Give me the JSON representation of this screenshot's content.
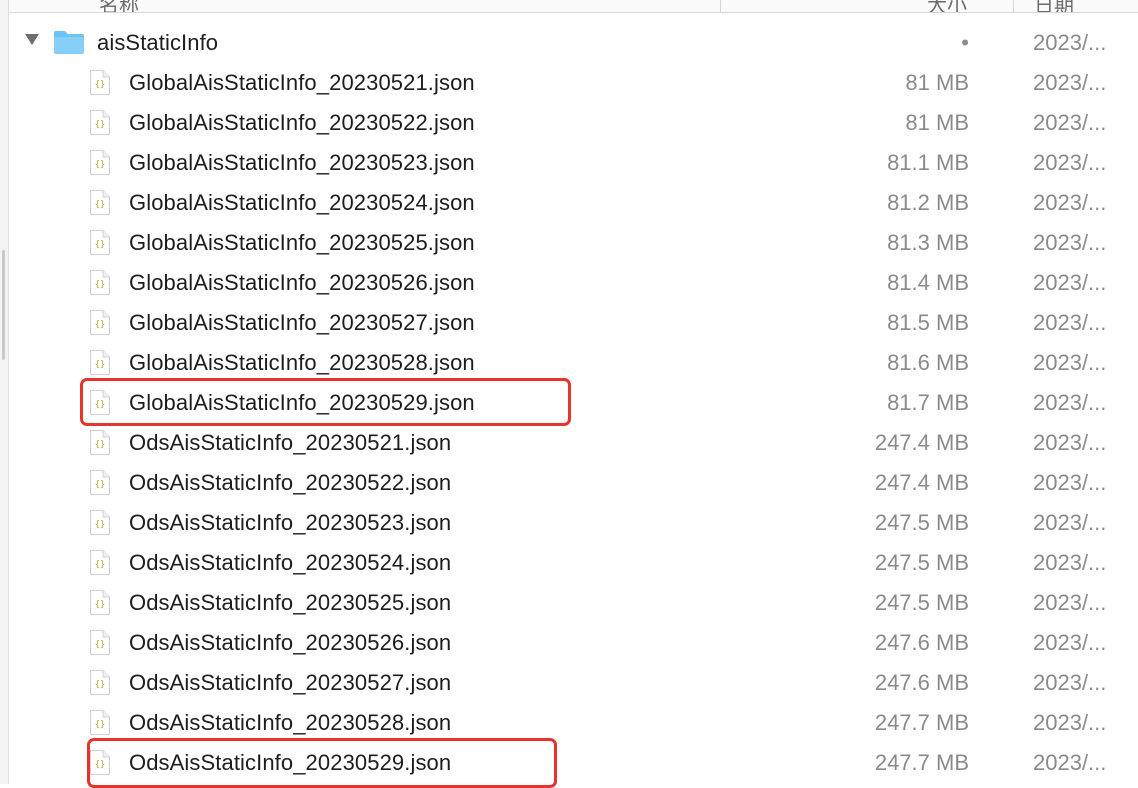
{
  "header": {
    "columns": [
      {
        "label": "名称"
      },
      {
        "label": "大小"
      },
      {
        "label": "日期"
      }
    ]
  },
  "folder": {
    "name": "aisStaticInfo",
    "size": "•",
    "date": "2023/...",
    "expanded": true,
    "icon": "folder-icon"
  },
  "files": [
    {
      "name": "GlobalAisStaticInfo_20230521.json",
      "size": "81 MB",
      "date": "2023/...",
      "highlighted": false
    },
    {
      "name": "GlobalAisStaticInfo_20230522.json",
      "size": "81 MB",
      "date": "2023/...",
      "highlighted": false
    },
    {
      "name": "GlobalAisStaticInfo_20230523.json",
      "size": "81.1 MB",
      "date": "2023/...",
      "highlighted": false
    },
    {
      "name": "GlobalAisStaticInfo_20230524.json",
      "size": "81.2 MB",
      "date": "2023/...",
      "highlighted": false
    },
    {
      "name": "GlobalAisStaticInfo_20230525.json",
      "size": "81.3 MB",
      "date": "2023/...",
      "highlighted": false
    },
    {
      "name": "GlobalAisStaticInfo_20230526.json",
      "size": "81.4 MB",
      "date": "2023/...",
      "highlighted": false
    },
    {
      "name": "GlobalAisStaticInfo_20230527.json",
      "size": "81.5 MB",
      "date": "2023/...",
      "highlighted": false
    },
    {
      "name": "GlobalAisStaticInfo_20230528.json",
      "size": "81.6 MB",
      "date": "2023/...",
      "highlighted": false
    },
    {
      "name": "GlobalAisStaticInfo_20230529.json",
      "size": "81.7 MB",
      "date": "2023/...",
      "highlighted": true
    },
    {
      "name": "OdsAisStaticInfo_20230521.json",
      "size": "247.4 MB",
      "date": "2023/...",
      "highlighted": false
    },
    {
      "name": "OdsAisStaticInfo_20230522.json",
      "size": "247.4 MB",
      "date": "2023/...",
      "highlighted": false
    },
    {
      "name": "OdsAisStaticInfo_20230523.json",
      "size": "247.5 MB",
      "date": "2023/...",
      "highlighted": false
    },
    {
      "name": "OdsAisStaticInfo_20230524.json",
      "size": "247.5 MB",
      "date": "2023/...",
      "highlighted": false
    },
    {
      "name": "OdsAisStaticInfo_20230525.json",
      "size": "247.5 MB",
      "date": "2023/...",
      "highlighted": false
    },
    {
      "name": "OdsAisStaticInfo_20230526.json",
      "size": "247.6 MB",
      "date": "2023/...",
      "highlighted": false
    },
    {
      "name": "OdsAisStaticInfo_20230527.json",
      "size": "247.6 MB",
      "date": "2023/...",
      "highlighted": false
    },
    {
      "name": "OdsAisStaticInfo_20230528.json",
      "size": "247.7 MB",
      "date": "2023/...",
      "highlighted": false
    },
    {
      "name": "OdsAisStaticInfo_20230529.json",
      "size": "247.7 MB",
      "date": "2023/...",
      "highlighted": true
    }
  ],
  "colors": {
    "highlight": "#e8322c",
    "folder_icon": "#6cc4f5",
    "json_icon_braces": "#b7a52a"
  }
}
